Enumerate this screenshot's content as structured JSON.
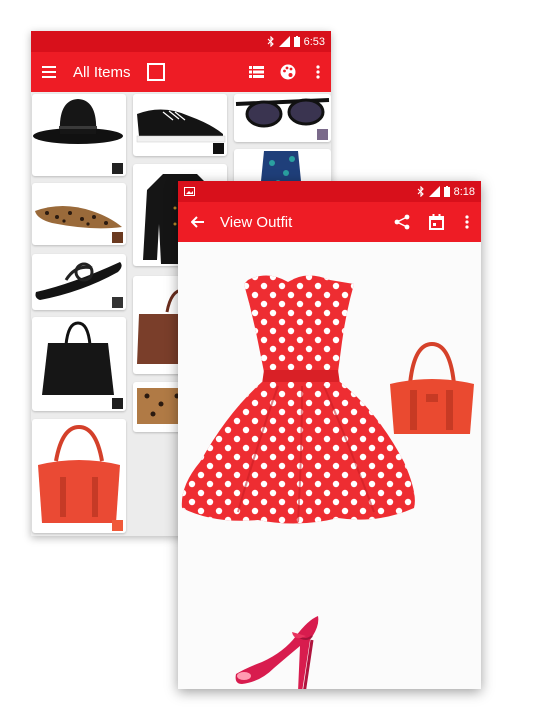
{
  "back_screen": {
    "status_time": "6:53",
    "title": "All Items",
    "icons": {
      "menu": "menu-icon",
      "checkbox": "select-all-checkbox",
      "list": "list-view-icon",
      "palette": "palette-icon",
      "more": "more-vert-icon"
    },
    "items": [
      {
        "name": "black-felt-hat",
        "swatch": "#222222"
      },
      {
        "name": "leopard-flats",
        "swatch": "#6b3a20"
      },
      {
        "name": "black-sandals",
        "swatch": "#333333"
      },
      {
        "name": "black-tote-bag",
        "swatch": "#1e1e1e"
      },
      {
        "name": "orange-handbag",
        "swatch": "#f05a3a"
      },
      {
        "name": "black-sneakers",
        "swatch": "#111111"
      },
      {
        "name": "black-jacket",
        "swatch": "#111111"
      },
      {
        "name": "brown-bag",
        "swatch": "#7a3e2a"
      },
      {
        "name": "leopard-clutch",
        "swatch": "#a06a3a"
      },
      {
        "name": "sunglasses",
        "swatch": "#7a6a8a"
      },
      {
        "name": "sequin-top",
        "swatch": "#2a3a6a"
      }
    ]
  },
  "front_screen": {
    "status_time": "8:18",
    "title": "View Outfit",
    "icons": {
      "back": "arrow-back-icon",
      "share": "share-icon",
      "calendar": "calendar-icon",
      "more": "more-vert-icon"
    },
    "outfit_items": [
      "red-polka-dot-dress",
      "orange-handbag",
      "pink-peep-toe-heels"
    ]
  },
  "colors": {
    "primary": "#ee1c25",
    "status": "#d8101b"
  }
}
